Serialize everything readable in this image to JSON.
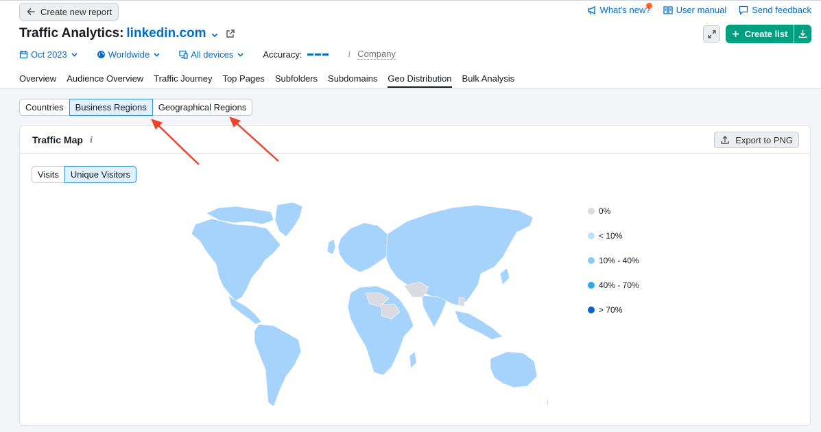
{
  "back_button": {
    "label": "Create new report"
  },
  "top_links": [
    {
      "label": "What's new?"
    },
    {
      "label": "User manual"
    },
    {
      "label": "Send feedback"
    }
  ],
  "title": {
    "prefix": "Traffic Analytics:",
    "domain": "linkedin.com"
  },
  "actions": {
    "create_list": "Create list"
  },
  "filters": {
    "date": "Oct 2023",
    "region": "Worldwide",
    "devices": "All devices",
    "accuracy_label": "Accuracy:",
    "company": "Company"
  },
  "tabs": [
    {
      "label": "Overview"
    },
    {
      "label": "Audience Overview"
    },
    {
      "label": "Traffic Journey"
    },
    {
      "label": "Top Pages"
    },
    {
      "label": "Subfolders"
    },
    {
      "label": "Subdomains"
    },
    {
      "label": "Geo Distribution",
      "active": true
    },
    {
      "label": "Bulk Analysis"
    }
  ],
  "region_segments": [
    {
      "label": "Countries"
    },
    {
      "label": "Business Regions",
      "selected": true
    },
    {
      "label": "Geographical Regions"
    }
  ],
  "card": {
    "title": "Traffic Map",
    "export": "Export to PNG"
  },
  "metric_segments": [
    {
      "label": "Visits"
    },
    {
      "label": "Unique Visitors",
      "selected": true
    }
  ],
  "legend": [
    {
      "label": "0%",
      "color": "#d9dbe0"
    },
    {
      "label": "< 10%",
      "color": "#c2e1f9"
    },
    {
      "label": "10% - 40%",
      "color": "#8cc8f7"
    },
    {
      "label": "40% - 70%",
      "color": "#2ba8f1"
    },
    {
      "label": "> 70%",
      "color": "#0f61c4"
    }
  ],
  "colors": {
    "accent": "#006dca",
    "brand_green": "#009f81",
    "map_fill": "#a6d3fb",
    "map_empty": "#d9dbe0",
    "annotation_arrow": "#f0412a"
  }
}
